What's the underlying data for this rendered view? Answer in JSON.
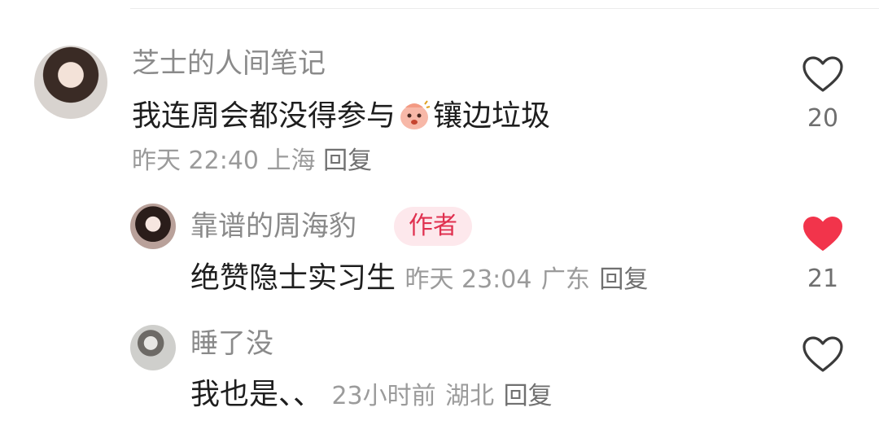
{
  "comments": [
    {
      "username": "芝士的人间笔记",
      "text_before": "我连周会都没得参与",
      "text_after": "镶边垃圾",
      "time": "昨天 22:40",
      "location": "上海",
      "reply_label": "回复",
      "likes": "20",
      "liked": false
    },
    {
      "username": "靠谱的周海豹",
      "badge": "作者",
      "text": "绝赞隐士实习生",
      "time": "昨天 23:04",
      "location": "广东",
      "reply_label": "回复",
      "likes": "21",
      "liked": true
    },
    {
      "username": "睡了没",
      "text": "我也是、、",
      "time": "23小时前",
      "location": "湖北",
      "reply_label": "回复",
      "likes": "",
      "liked": false
    }
  ],
  "colors": {
    "liked": "#f2344b",
    "badge_bg": "#fde8ec",
    "badge_text": "#e0304f"
  }
}
